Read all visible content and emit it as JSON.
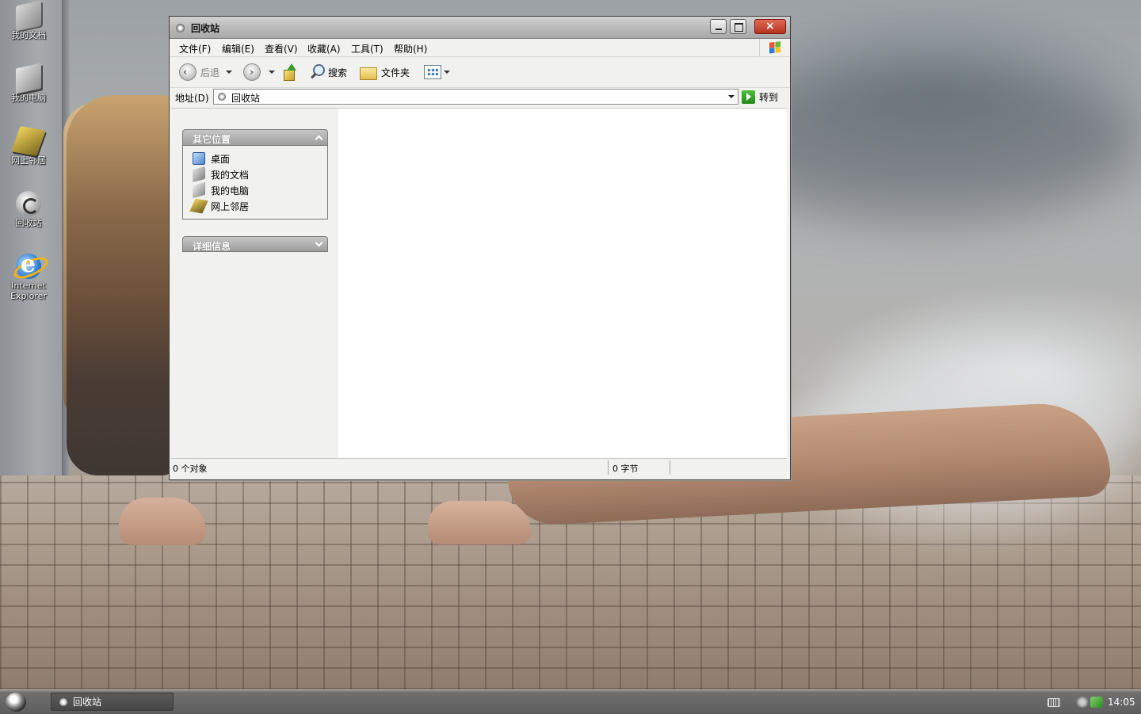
{
  "desktop": {
    "icons": [
      {
        "label": "我的文档",
        "icon": "documents-icon"
      },
      {
        "label": "我的电脑",
        "icon": "computer-icon"
      },
      {
        "label": "网上邻居",
        "icon": "network-icon"
      },
      {
        "label": "回收站",
        "icon": "recycle-bin-icon"
      },
      {
        "label_line1": "Internet",
        "label_line2": "Explorer",
        "icon": "internet-explorer-icon"
      }
    ]
  },
  "window": {
    "title": "回收站",
    "menu": [
      "文件(F)",
      "编辑(E)",
      "查看(V)",
      "收藏(A)",
      "工具(T)",
      "帮助(H)"
    ],
    "toolbar": {
      "back": "后退",
      "search": "搜索",
      "folders": "文件夹"
    },
    "address": {
      "label": "地址(D)",
      "value": "回收站",
      "go": "转到"
    },
    "taskpane": {
      "other_places": {
        "title": "其它位置",
        "items": [
          "桌面",
          "我的文档",
          "我的电脑",
          "网上邻居"
        ]
      },
      "details": {
        "title": "详细信息"
      }
    },
    "status": {
      "objects": "0 个对象",
      "size": "0 字节"
    }
  },
  "taskbar": {
    "task_label": "回收站",
    "clock": "14:05"
  },
  "colors": {
    "titlebar": "#b9b9b9",
    "close_button": "#c8422c",
    "taskbar": "#5e5e5e"
  }
}
